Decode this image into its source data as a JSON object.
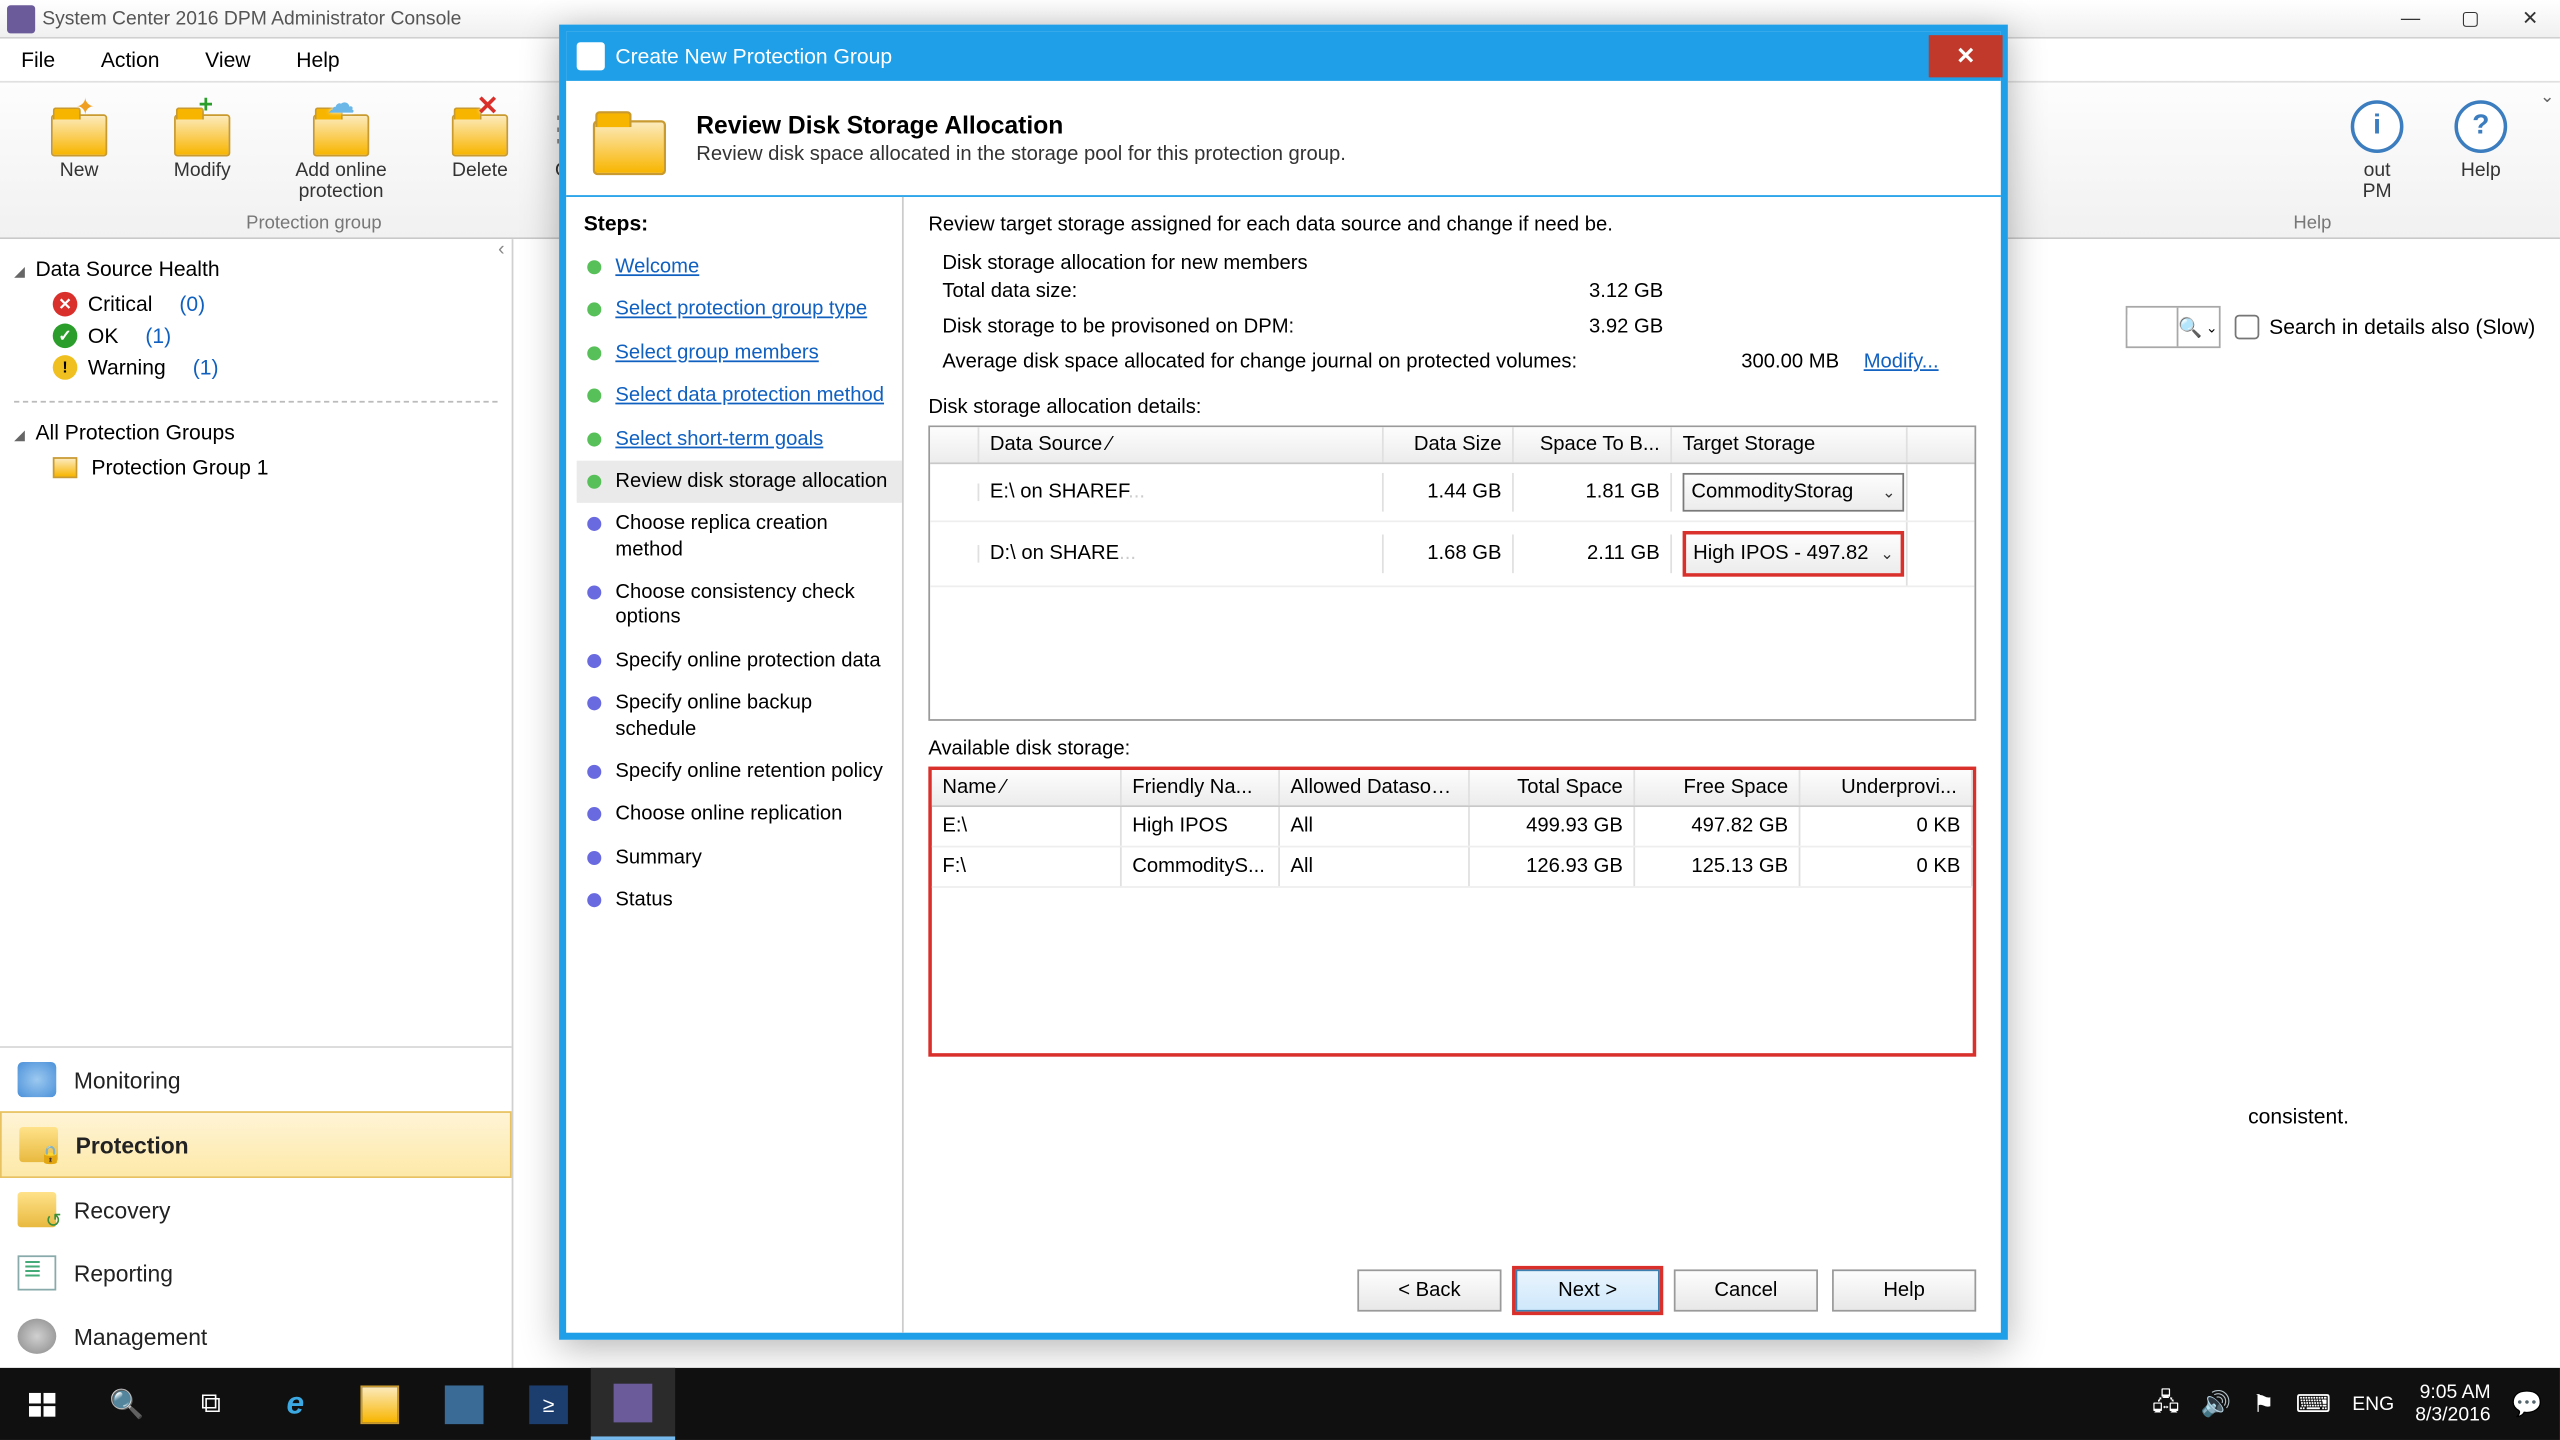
{
  "window": {
    "title": "System Center 2016 DPM Administrator Console"
  },
  "menus": [
    "File",
    "Action",
    "View",
    "Help"
  ],
  "toolbar": {
    "new": "New",
    "modify": "Modify",
    "addonline": "Add online protection",
    "delete": "Delete",
    "options_cut": "Op",
    "about_cut": "out\nPM",
    "help": "Help",
    "group_left": "Protection group",
    "group_right": "Help"
  },
  "nav": {
    "dsh": "Data Source Health",
    "critical_label": "Critical",
    "critical_count": "(0)",
    "ok_label": "OK",
    "ok_count": "(1)",
    "warn_label": "Warning",
    "warn_count": "(1)",
    "apg": "All Protection Groups",
    "pg1": "Protection Group 1",
    "monitoring": "Monitoring",
    "protection": "Protection",
    "recovery": "Recovery",
    "reporting": "Reporting",
    "management": "Management"
  },
  "search": {
    "placeholder": "",
    "chk_label": "Search in details also (Slow)"
  },
  "extra_right": "consistent.",
  "dialog": {
    "title": "Create New Protection Group",
    "head_h": "Review Disk Storage Allocation",
    "head_p": "Review disk space allocated in the storage pool for this protection group.",
    "steps_h": "Steps:",
    "steps": [
      {
        "t": "Welcome",
        "s": "done",
        "link": true
      },
      {
        "t": "Select protection group type",
        "s": "done",
        "link": true
      },
      {
        "t": "Select group members",
        "s": "done",
        "link": true
      },
      {
        "t": "Select data protection method",
        "s": "done",
        "link": true
      },
      {
        "t": "Select short-term goals",
        "s": "done",
        "link": true
      },
      {
        "t": "Review disk storage allocation",
        "s": "current",
        "link": false
      },
      {
        "t": "Choose replica creation method",
        "s": "todo",
        "link": false
      },
      {
        "t": "Choose consistency check options",
        "s": "todo",
        "link": false
      },
      {
        "t": "Specify online protection data",
        "s": "todo",
        "link": false
      },
      {
        "t": "Specify online backup schedule",
        "s": "todo",
        "link": false
      },
      {
        "t": "Specify online retention policy",
        "s": "todo",
        "link": false
      },
      {
        "t": "Choose online replication",
        "s": "todo",
        "link": false
      },
      {
        "t": "Summary",
        "s": "todo",
        "link": false
      },
      {
        "t": "Status",
        "s": "todo",
        "link": false
      }
    ],
    "intro": "Review target storage assigned for each data source and change if need be.",
    "alloc_h": "Disk storage allocation for new members",
    "row_tds": {
      "k": "Total data size:",
      "v": "3.12 GB"
    },
    "row_prov": {
      "k": "Disk storage to be provisoned on DPM:",
      "v": "3.92 GB"
    },
    "row_avg": {
      "k": "Average disk space allocated for change journal on protected volumes:",
      "v": "300.00 MB",
      "link": "Modify..."
    },
    "details_h": "Disk storage allocation details:",
    "details_cols": [
      "",
      "Data Source   ⁄",
      "Data Size",
      "Space To B...",
      "Target Storage"
    ],
    "details_rows": [
      {
        "src": "E:\\  on  SHAREF",
        "size": "1.44 GB",
        "space": "1.81 GB",
        "target": "CommodityStorag",
        "hl": false
      },
      {
        "src": "D:\\  on  SHARE",
        "size": "1.68 GB",
        "space": "2.11 GB",
        "target": "High IPOS - 497.82",
        "hl": true
      }
    ],
    "avail_h": "Available disk storage:",
    "avail_cols": [
      "Name   ⁄",
      "Friendly Na...",
      "Allowed Datasou...",
      "Total Space",
      "Free Space",
      "Underprovi..."
    ],
    "avail_rows": [
      {
        "n": "E:\\",
        "f": "High IPOS",
        "a": "All",
        "t": "499.93 GB",
        "free": "497.82 GB",
        "u": "0 KB"
      },
      {
        "n": "F:\\",
        "f": "CommodityS...",
        "a": "All",
        "t": "126.93 GB",
        "free": "125.13 GB",
        "u": "0 KB"
      }
    ],
    "btn_back": "< Back",
    "btn_next": "Next >",
    "btn_cancel": "Cancel",
    "btn_help": "Help"
  },
  "tray": {
    "lang": "ENG",
    "time": "9:05 AM",
    "date": "8/3/2016"
  }
}
